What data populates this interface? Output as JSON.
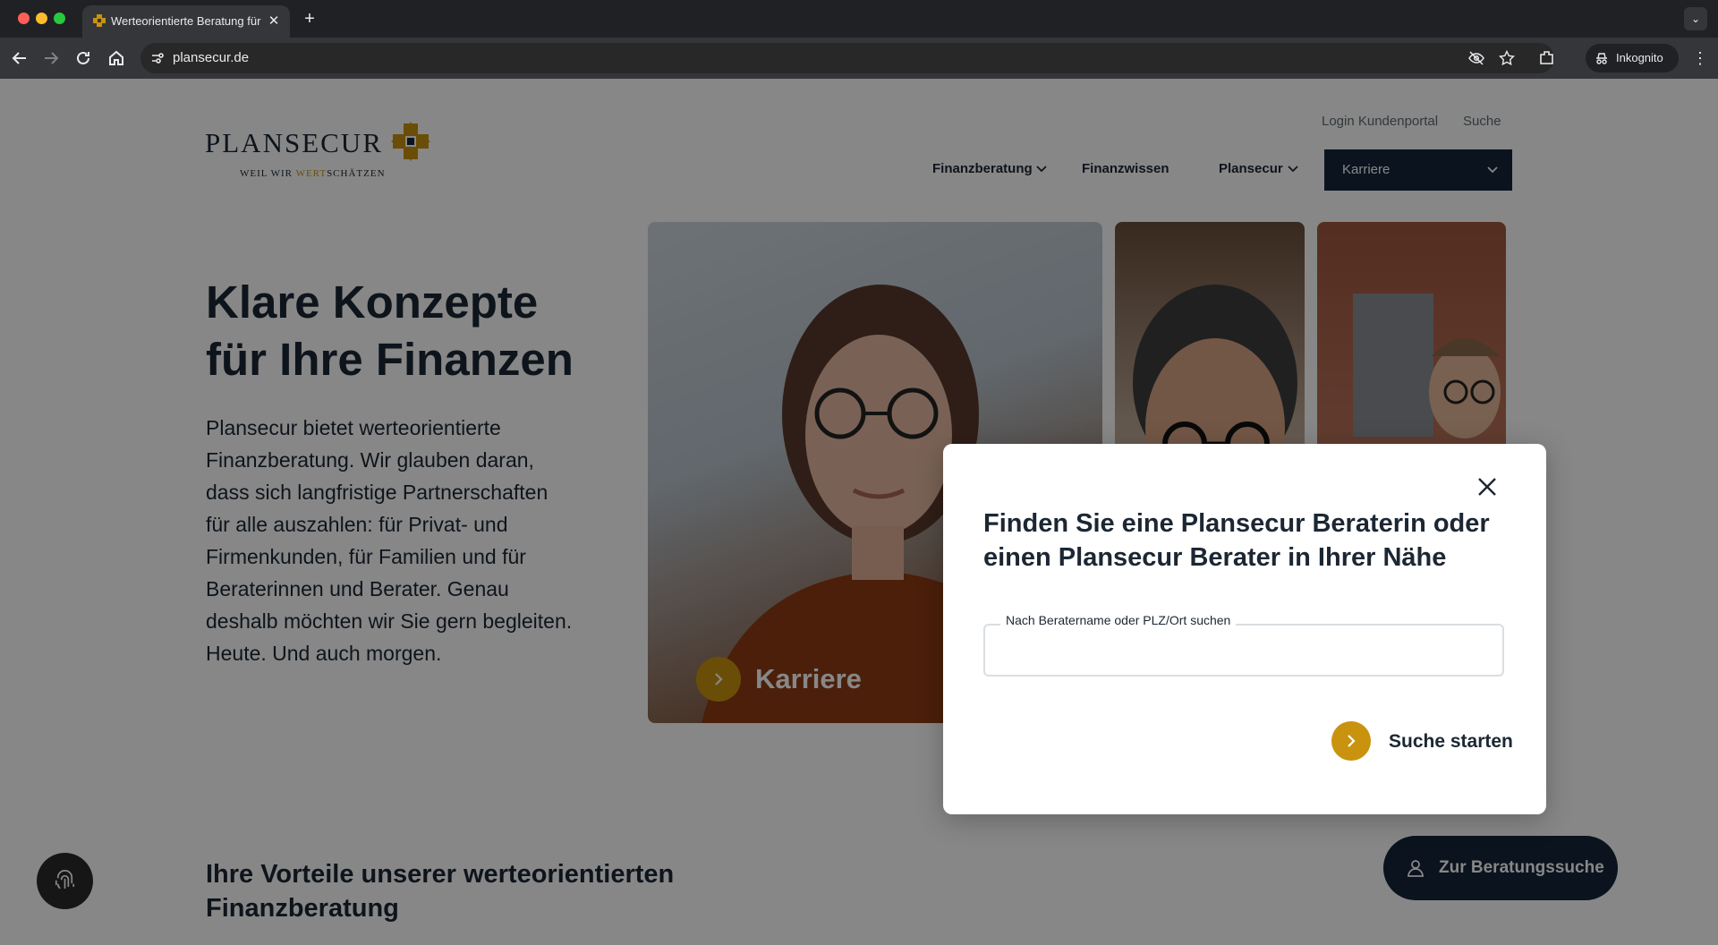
{
  "browser": {
    "tab_title": "Werteorientierte Beratung für",
    "url": "plansecur.de",
    "incognito_label": "Inkognito"
  },
  "header": {
    "logo_word": "PLANSECUR",
    "logo_tag_start": "WEIL WIR ",
    "logo_tag_accent": "WERT",
    "logo_tag_end": "SCHÄTZEN",
    "util_links": [
      "Login Kundenportal",
      "Suche"
    ],
    "nav": {
      "finanzberatung": "Finanzberatung",
      "finanzwissen": "Finanzwissen",
      "plansecur": "Plansecur",
      "karriere": "Karriere"
    }
  },
  "hero": {
    "title": "Klare Konzepte für Ihre Finanzen",
    "text": "Plansecur bietet werteorientierte Finanzberatung. Wir glauben daran, dass sich langfristige Partnerschaften für alle auszahlen: für Privat- und Firmenkunden, für Familien und für Beraterinnen und Berater. Genau deshalb möchten wir Sie gern begleiten. Heute. Und auch morgen.",
    "card_label": "Karriere"
  },
  "section": {
    "title": "Ihre Vorteile unserer werteorientierten Finanzberatung"
  },
  "floating": {
    "consult_label": "Zur Beratungssuche"
  },
  "modal": {
    "title": "Finden Sie eine Plansecur Beraterin oder einen Plansecur Berater in Ihrer Nähe",
    "field_label": "Nach Beratername oder PLZ/Ort suchen",
    "field_value": "",
    "submit_label": "Suche starten"
  },
  "colors": {
    "accent_gold": "#c9930f",
    "navy": "#13253a",
    "text_dark": "#1c2733"
  }
}
